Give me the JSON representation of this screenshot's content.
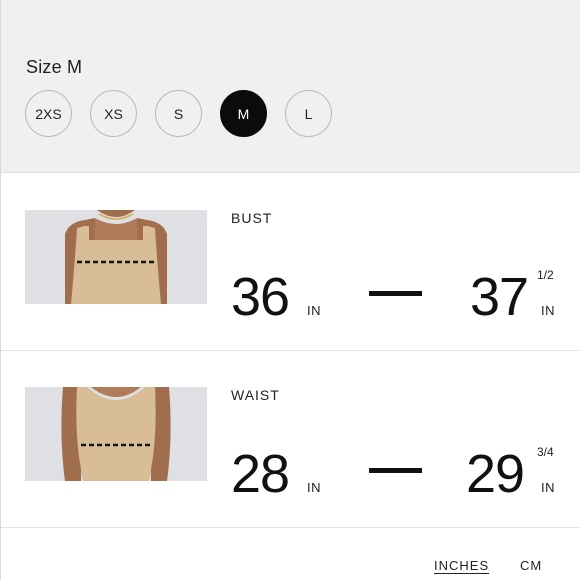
{
  "header": {
    "size_title": "Size M"
  },
  "sizes": [
    "2XS",
    "XS",
    "S",
    "M",
    "L"
  ],
  "selected_size": "M",
  "measurements": {
    "bust": {
      "label": "BUST",
      "min": "36",
      "min_unit": "IN",
      "max": "37",
      "max_fraction": "1/2",
      "max_unit": "IN"
    },
    "waist": {
      "label": "WAIST",
      "min": "28",
      "min_unit": "IN",
      "max": "29",
      "max_fraction": "3/4",
      "max_unit": "IN"
    }
  },
  "units": {
    "inches": "INCHES",
    "cm": "CM",
    "active": "INCHES"
  },
  "colors": {
    "selected_bg": "#0b0b0b",
    "header_bg": "#f0f0f0",
    "garment": "#d8bd97"
  }
}
